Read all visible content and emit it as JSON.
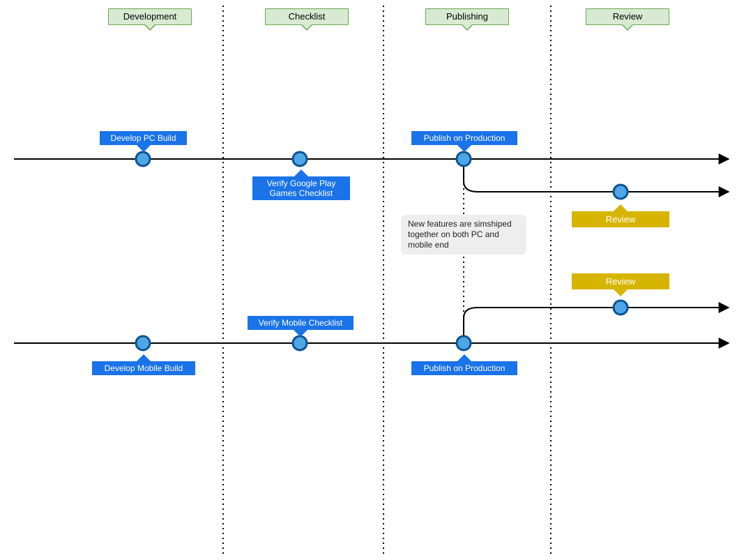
{
  "colors": {
    "phase_bg": "#d9ead3",
    "phase_border": "#6aa84f",
    "step_bg": "#1a73e8",
    "review_bg": "#d6b500",
    "node_fill": "#4ea6e6",
    "node_stroke": "#0b5394",
    "note_bg": "#eeeeee",
    "line": "#000000"
  },
  "phases": {
    "development": "Development",
    "checklist": "Checklist",
    "publishing": "Publishing",
    "review": "Review"
  },
  "pc": {
    "develop": "Develop PC Build",
    "verify": "Verify Google Play Games Checklist",
    "publish": "Publish on Production",
    "review": "Review"
  },
  "mobile": {
    "develop": "Develop Mobile Build",
    "verify": "Verify Mobile Checklist",
    "publish": "Publish on Production",
    "review": "Review"
  },
  "note": "New features are simshiped together on both PC and mobile end"
}
